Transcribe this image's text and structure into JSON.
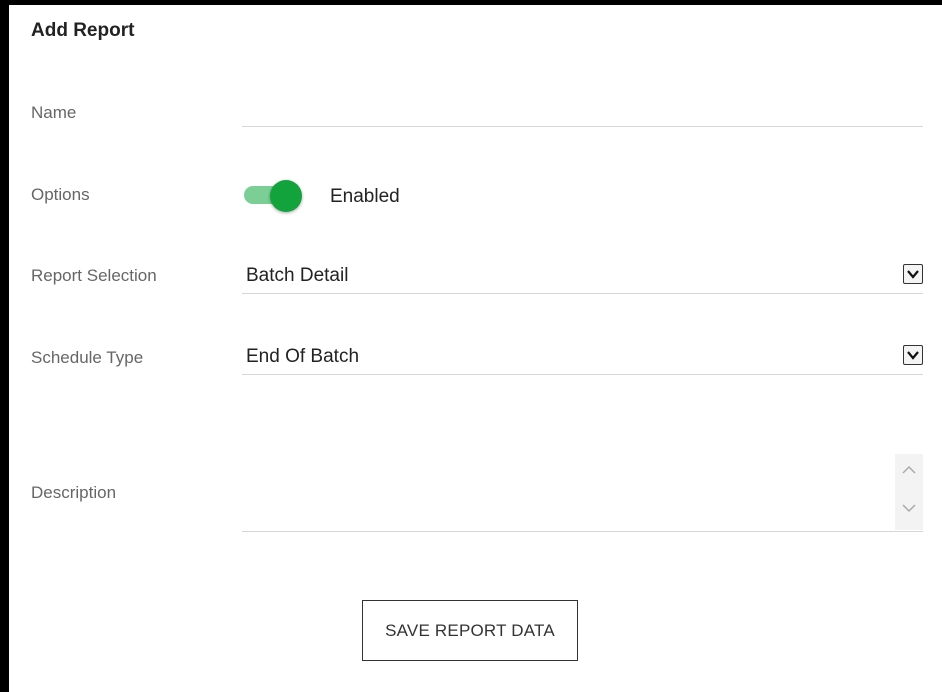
{
  "form": {
    "title": "Add Report",
    "name": {
      "label": "Name",
      "value": "",
      "placeholder": ""
    },
    "options": {
      "label": "Options",
      "toggle_state": "on",
      "toggle_text": "Enabled"
    },
    "report_selection": {
      "label": "Report Selection",
      "value": "Batch Detail"
    },
    "schedule_type": {
      "label": "Schedule Type",
      "value": "End Of Batch"
    },
    "description": {
      "label": "Description",
      "value": ""
    },
    "save_button_label": "SAVE REPORT DATA"
  },
  "icons": {
    "dropdown": "chevron-down-icon",
    "scroll_up": "chevron-up-icon",
    "scroll_down": "chevron-down-icon"
  },
  "colors": {
    "toggle_knob": "#12a33c",
    "toggle_track": "#7bcf96",
    "label_text": "#666666",
    "frame": "#000000"
  }
}
